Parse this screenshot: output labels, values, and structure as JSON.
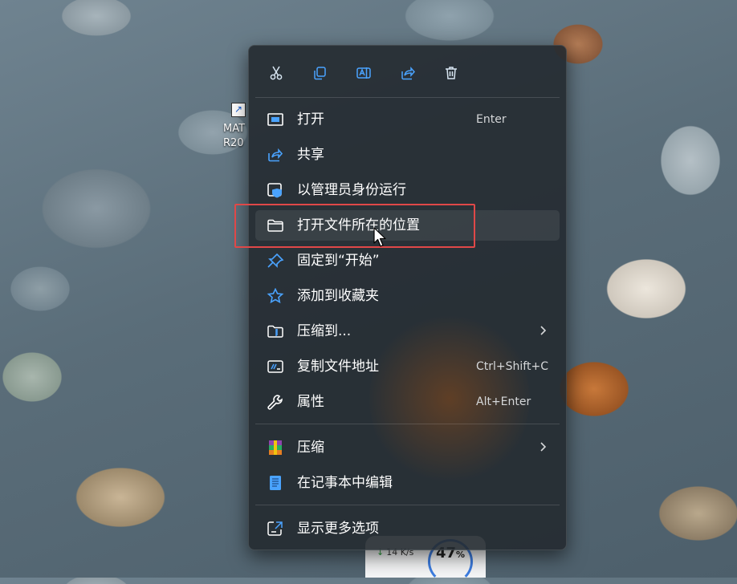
{
  "desktop": {
    "shortcut_label": "MAT\nR20"
  },
  "toolbar": {
    "cut": "scissors-icon",
    "copy": "copy-icon",
    "rename": "rename-icon",
    "share": "share-icon",
    "delete": "trash-icon"
  },
  "menu": {
    "items": [
      {
        "label": "打开",
        "shortcut": "Enter",
        "icon": "open-window-icon"
      },
      {
        "label": "共享",
        "shortcut": "",
        "icon": "share-icon"
      },
      {
        "label": "以管理员身份运行",
        "shortcut": "",
        "icon": "admin-shield-icon"
      },
      {
        "label": "打开文件所在的位置",
        "shortcut": "",
        "icon": "folder-icon"
      },
      {
        "label": "固定到“开始”",
        "shortcut": "",
        "icon": "pin-icon"
      },
      {
        "label": "添加到收藏夹",
        "shortcut": "",
        "icon": "star-icon"
      },
      {
        "label": "压缩到...",
        "shortcut": "",
        "icon": "zip-folder-icon"
      },
      {
        "label": "复制文件地址",
        "shortcut": "Ctrl+Shift+C",
        "icon": "copy-path-icon"
      },
      {
        "label": "属性",
        "shortcut": "Alt+Enter",
        "icon": "wrench-icon"
      },
      {
        "label": "压缩",
        "shortcut": "",
        "icon": "winrar-icon"
      },
      {
        "label": "在记事本中编辑",
        "shortcut": "",
        "icon": "notepad-icon"
      },
      {
        "label": "显示更多选项",
        "shortcut": "",
        "icon": "more-options-icon"
      }
    ]
  },
  "taskbar_widget": {
    "net_speed": "14 K/s",
    "percent": "47",
    "percent_unit": "%"
  },
  "colors": {
    "menu_bg": "#242a30",
    "highlight_border": "#e04848",
    "accent_blue": "#4aa3ff"
  }
}
